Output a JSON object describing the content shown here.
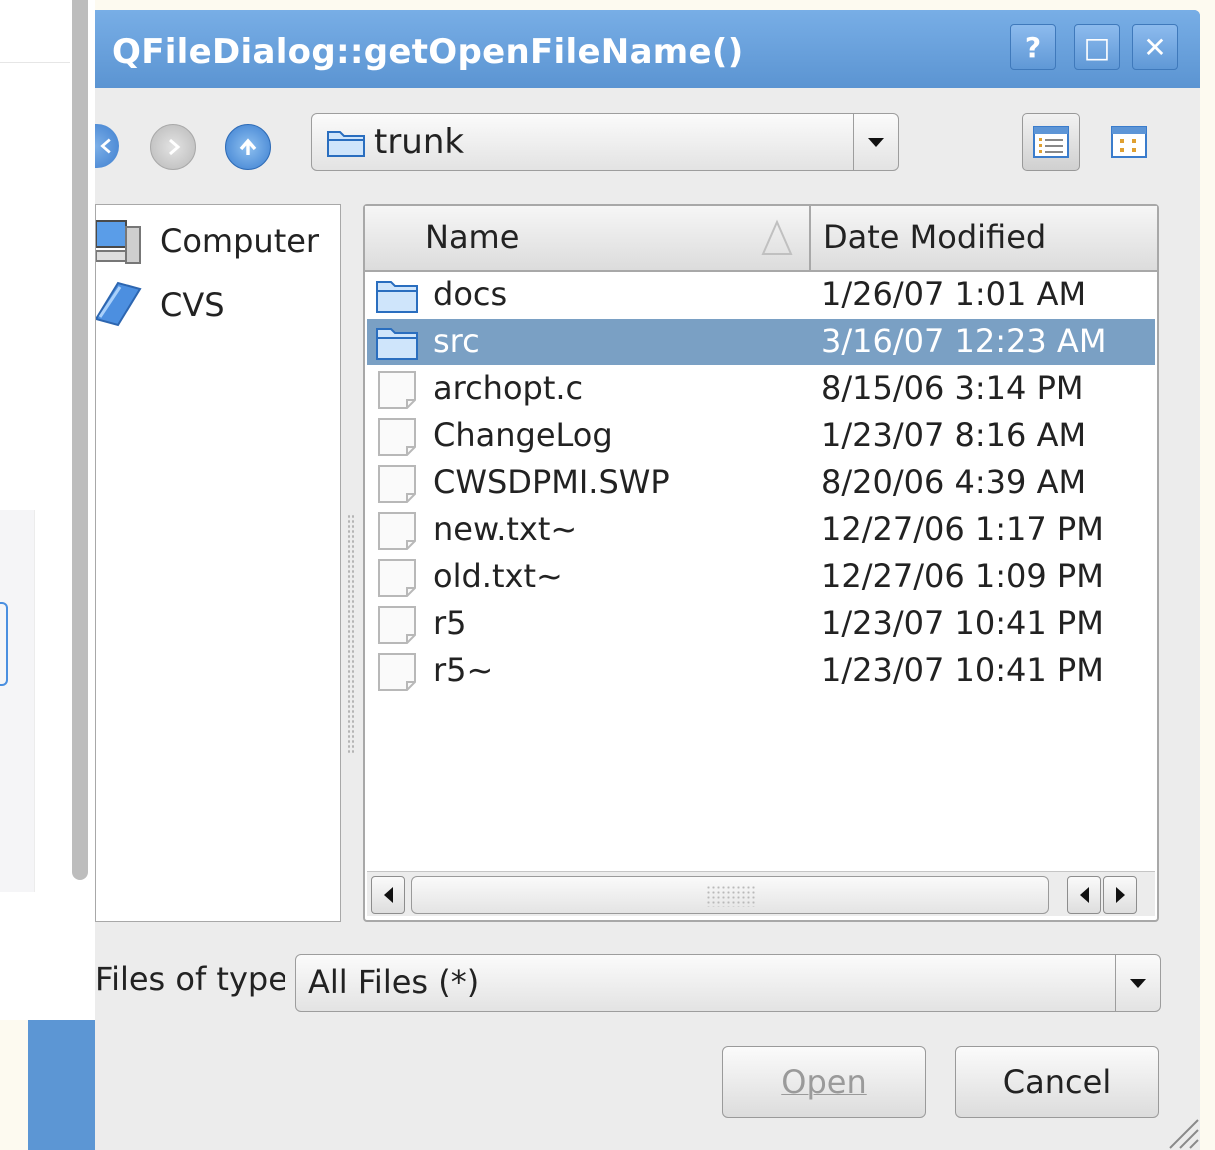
{
  "window": {
    "title": "QFileDialog::getOpenFileName()",
    "help_label": "?",
    "maximize_label": "□",
    "close_label": "✕"
  },
  "toolbar": {
    "look_in_value": "trunk"
  },
  "sidebar": {
    "items": [
      {
        "label": "Computer",
        "icon": "computer-icon"
      },
      {
        "label": "CVS",
        "icon": "folder-icon"
      }
    ]
  },
  "filelist": {
    "columns": [
      "Name",
      "Date Modified"
    ],
    "rows": [
      {
        "name": "docs",
        "date": "1/26/07 1:01 AM",
        "type": "folder",
        "selected": false
      },
      {
        "name": "src",
        "date": "3/16/07 12:23 AM",
        "type": "folder",
        "selected": true
      },
      {
        "name": "archopt.c",
        "date": "8/15/06 3:14 PM",
        "type": "file",
        "selected": false
      },
      {
        "name": "ChangeLog",
        "date": "1/23/07 8:16 AM",
        "type": "file",
        "selected": false
      },
      {
        "name": "CWSDPMI.SWP",
        "date": "8/20/06 4:39 AM",
        "type": "file",
        "selected": false
      },
      {
        "name": "new.txt~",
        "date": "12/27/06 1:17 PM",
        "type": "file",
        "selected": false
      },
      {
        "name": "old.txt~",
        "date": "12/27/06 1:09 PM",
        "type": "file",
        "selected": false
      },
      {
        "name": "r5",
        "date": "1/23/07 10:41 PM",
        "type": "file",
        "selected": false
      },
      {
        "name": "r5~",
        "date": "1/23/07 10:41 PM",
        "type": "file",
        "selected": false
      }
    ]
  },
  "filetype": {
    "label": "Files of type:",
    "value": "All Files (*)"
  },
  "buttons": {
    "open_label": "Open",
    "cancel_label": "Cancel"
  },
  "colors": {
    "titlebar": "#5c96d4",
    "selection": "#7aa0c4",
    "window_bg": "#ececec"
  }
}
